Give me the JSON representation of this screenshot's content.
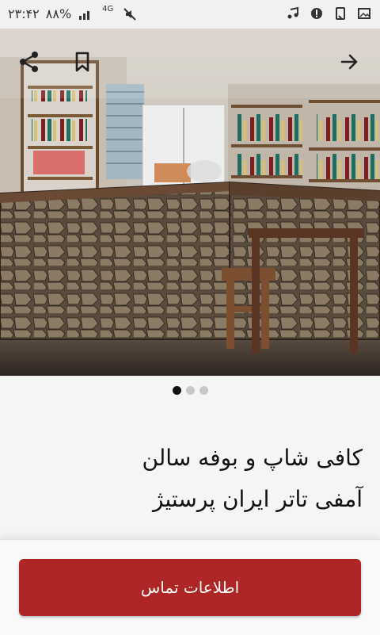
{
  "status_bar": {
    "time": "۲۳:۴۲",
    "battery": "۸۸%",
    "network": "4G",
    "left_icons": [
      "music-note-icon",
      "settings-alert-icon",
      "phone-document-icon",
      "gallery-icon"
    ],
    "right_icons": [
      "signal-bars-icon",
      "mute-icon"
    ]
  },
  "hero": {
    "share_icon": "share-icon",
    "bookmark_icon": "bookmark-icon",
    "forward_icon": "arrow-right-icon",
    "image_description_hidden": true
  },
  "carousel": {
    "current_index": 1,
    "count": 3
  },
  "listing": {
    "title_line1": "کافی شاپ و بوفه سالن",
    "title_line2": "آمفی تاتر ایران پرستیژ"
  },
  "actions": {
    "contact_label": "اطلاعات تماس",
    "contact_color": "#ad2524"
  }
}
